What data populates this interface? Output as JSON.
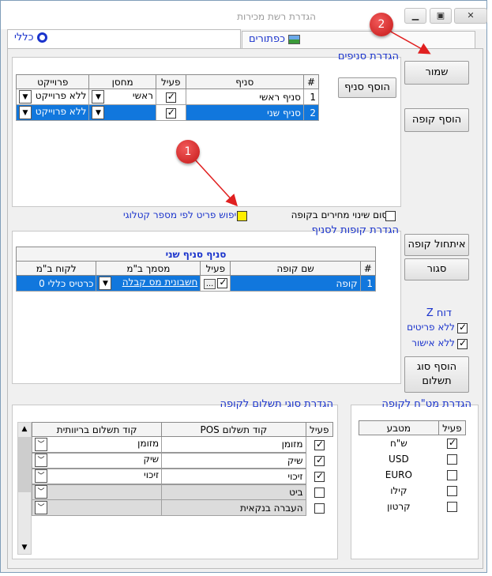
{
  "window": {
    "title": "הגדרת רשת מכירות"
  },
  "tabs": [
    {
      "label": "כללי"
    },
    {
      "label": "כפתורים"
    }
  ],
  "buttons": {
    "save": "שמור",
    "add_register": "הוסף קופה",
    "add_branch": "הוסף סניף",
    "init_register": "איתחול קופה",
    "closed": "סגור",
    "add_payment_type": "הוסף סוג תשלום"
  },
  "branches": {
    "title": "הגדרת סניפים",
    "columns": [
      "#",
      "סניף",
      "פעיל",
      "מחסן",
      "פרוייקט"
    ],
    "rows": [
      {
        "num": "1",
        "name": "סניף ראשי",
        "active": true,
        "warehouse": "ראשי",
        "project": "ללא פרוייקט"
      },
      {
        "num": "2",
        "name": "סניף שני",
        "active": true,
        "warehouse": "",
        "project": "ללא פרוייקט"
      }
    ]
  },
  "options": {
    "block_price_changes": "חסום שינוי מחירים בקופה",
    "search_by_catalog": "חיפוש פריט לפי מספר קטלוגי"
  },
  "registers": {
    "title": "הגדרת קופות לסניף",
    "group_header": "סניף סניף שני",
    "columns": [
      "#",
      "שם קופה",
      "פעיל",
      "מסמך ב\"מ",
      "לקוח ב\"מ"
    ],
    "rows": [
      {
        "num": "1",
        "name": "קופה",
        "active": true,
        "doc": "חשבונית מס קבלה",
        "customer": "כרטיס כללי 0"
      }
    ]
  },
  "zreport": {
    "title": "דוח Z",
    "no_items": "ללא פריטים",
    "no_approval": "ללא אישור"
  },
  "payments": {
    "title": "הגדרת סוגי תשלום לקופה",
    "columns": [
      "פעיל",
      "קוד תשלום POS",
      "קוד תשלום בריוותית"
    ],
    "rows": [
      {
        "active": true,
        "pos": "מזומן",
        "code": "מזומן"
      },
      {
        "active": true,
        "pos": "שיק",
        "code": "שיק"
      },
      {
        "active": true,
        "pos": "זיכוי",
        "code": "זיכוי"
      },
      {
        "active": false,
        "pos": "ביט",
        "code": ""
      },
      {
        "active": false,
        "pos": "העברה בנקאית",
        "code": ""
      }
    ]
  },
  "currencies": {
    "title": "הגדרת מט\"ח לקופה",
    "columns": [
      "פעיל",
      "מטבע"
    ],
    "rows": [
      {
        "active": true,
        "name": "ש\"ח"
      },
      {
        "active": false,
        "name": "USD"
      },
      {
        "active": false,
        "name": "EURO"
      },
      {
        "active": false,
        "name": "קילו"
      },
      {
        "active": false,
        "name": "קרטון"
      }
    ]
  },
  "annotations": [
    "1",
    "2"
  ],
  "colors": {
    "accent": "#1a33cc",
    "selection": "#1177dd",
    "callout": "#e02020"
  }
}
